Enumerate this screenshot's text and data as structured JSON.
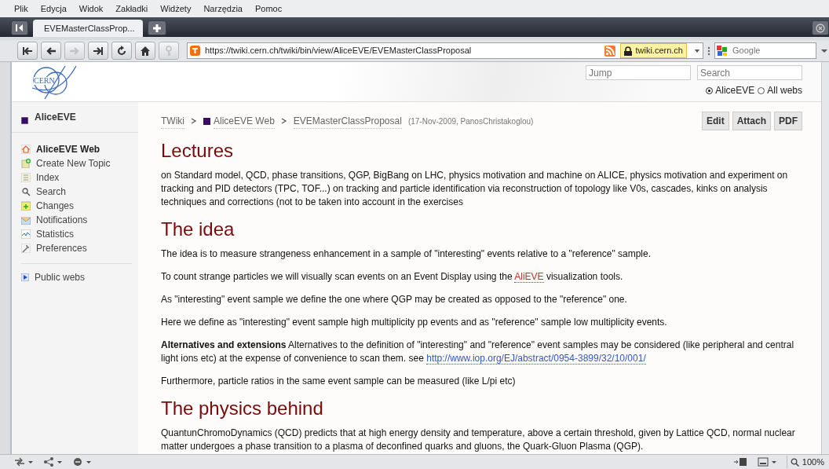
{
  "menu": [
    "Plik",
    "Edycja",
    "Widok",
    "Zakładki",
    "Widżety",
    "Narzędzia",
    "Pomoc"
  ],
  "tabs": [
    {
      "label": "EVEMasterClassProp...",
      "selected": true
    }
  ],
  "nav_buttons": [
    {
      "kind": "first",
      "disabled": false
    },
    {
      "kind": "back",
      "disabled": false
    },
    {
      "kind": "forward",
      "disabled": true
    },
    {
      "kind": "last",
      "disabled": false
    },
    {
      "kind": "reload",
      "disabled": false
    },
    {
      "kind": "home",
      "disabled": false
    },
    {
      "kind": "key",
      "disabled": true
    }
  ],
  "address": {
    "url": "https://twiki.cern.ch/twiki/bin/view/AliceEVE/EVEMasterClassProposal",
    "site": "twiki.cern.ch"
  },
  "search_engine": {
    "placeholder": "Google"
  },
  "header": {
    "logo_text": "CERN",
    "jump_placeholder": "Jump",
    "search_placeholder": "Search",
    "scopes": [
      {
        "label": "AliceEVE",
        "selected": true
      },
      {
        "label": "All webs",
        "selected": false
      }
    ]
  },
  "sidebar": {
    "web": "AliceEVE",
    "items": [
      {
        "label": "AliceEVE Web",
        "kind": "home",
        "selected": true
      },
      {
        "label": "Create New Topic",
        "kind": "new",
        "selected": false
      },
      {
        "label": "Index",
        "kind": "index",
        "selected": false
      },
      {
        "label": "Search",
        "kind": "search",
        "selected": false
      },
      {
        "label": "Changes",
        "kind": "changes",
        "selected": false
      },
      {
        "label": "Notifications",
        "kind": "notify",
        "selected": false
      },
      {
        "label": "Statistics",
        "kind": "stats",
        "selected": false
      },
      {
        "label": "Preferences",
        "kind": "prefs",
        "selected": false
      }
    ],
    "public_webs": "Public webs"
  },
  "breadcrumb": [
    {
      "label": "TWiki"
    },
    {
      "label": "AliceEVE Web"
    },
    {
      "label": "EVEMasterClassProposal"
    }
  ],
  "revision": "(17-Nov-2009, PanosChristakoglou)",
  "actions": [
    "Edit",
    "Attach",
    "PDF"
  ],
  "sections": [
    {
      "heading": "Lectures",
      "paragraphs": [
        [
          {
            "text": "on Standard model, QCD, phase transitions, QGP, BigBang on LHC, physics motivation and machine on ALICE, physics motivation and experiment on tracking and PID detectors (TPC, TOF...) on tracking and particle identification via reconstruction of topology like V0s, cascades, kinks on analysis techniques and corrections (not to be taken into account in the exercises"
          }
        ]
      ]
    },
    {
      "heading": "The idea",
      "paragraphs": [
        [
          {
            "text": "The idea is to measure strangeness enhancement in a sample of \"interesting\" events relative to a \"reference\" sample."
          }
        ],
        [
          {
            "text": "To count strange particles we will visually scan events on an Event Display using the "
          },
          {
            "link": "AliEVE",
            "kind": "topic"
          },
          {
            "text": " visualization tools."
          }
        ],
        [
          {
            "text": "As \"interesting\" event sample we define the one where QGP may be created as opposed to the \"reference\" one."
          }
        ],
        [
          {
            "text": "Here we define as \"interesting\" event sample high multiplicity pp events and as \"reference\" sample low multiplicity events."
          }
        ],
        [
          {
            "text": "**Alternatives and extensions** Alternatives to the definition of \"interesting\" and \"reference\" event samples may be considered (like peripheral and central light ions etc) at the expense of convenience to scan them. see "
          },
          {
            "link": "http://www.iop.org/EJ/abstract/0954-3899/32/10/001/",
            "kind": "external"
          }
        ],
        [
          {
            "text": "Furthermore, particle ratios in the same event sample can be measured (like L/pi etc)"
          }
        ]
      ]
    },
    {
      "heading": "The physics behind",
      "paragraphs": [
        [
          {
            "text": "QuantunChromoDynamics (QCD) predicts that at high energy density and temperature, above a certain threshold, given by Lattice QCD, normal nuclear matter undergoes a phase transition to a plasma of deconfined quarks and gluons, the Quark-Gluon Plasma (QGP)."
          }
        ]
      ]
    }
  ],
  "status": {
    "zoom": "100%"
  }
}
